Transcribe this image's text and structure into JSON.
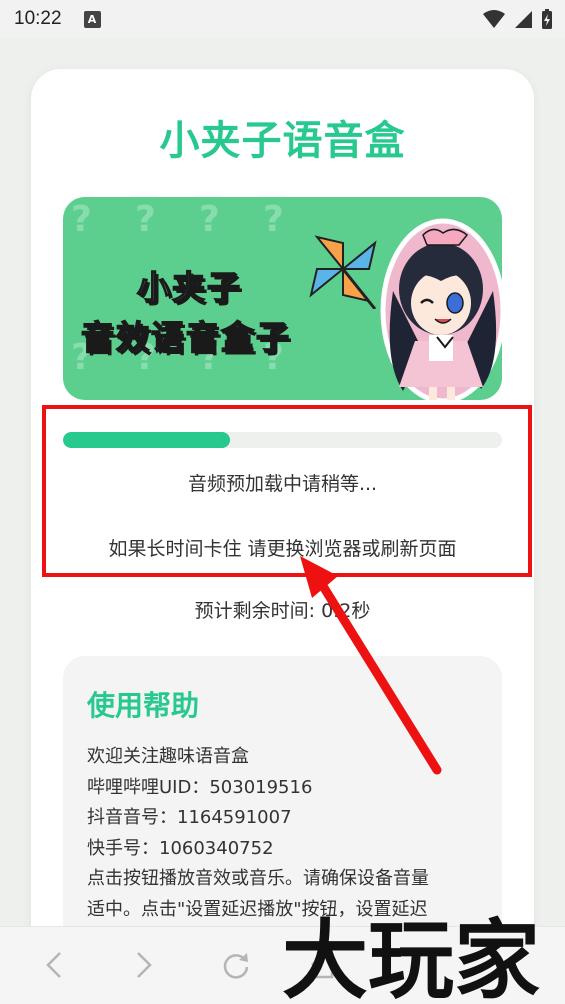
{
  "status_bar": {
    "time": "10:22",
    "notification_letter": "A"
  },
  "app": {
    "title": "小夹子语音盒"
  },
  "banner": {
    "line1": "小夹子",
    "line2": "音效语音盒子"
  },
  "loading": {
    "progress_percent": 38,
    "message": "音频预加载中请稍等...",
    "hint": "如果长时间卡住 请更换浏览器或刷新页面",
    "eta": "预计剩余时间: 0.2秒"
  },
  "help": {
    "title": "使用帮助",
    "lines": [
      "欢迎关注趣味语音盒",
      "哔哩哔哩UID：503019516",
      "抖音音号：1164591007",
      "快手号：1060340752",
      "点击按钮播放音效或音乐。请确保设备音量",
      "适中。点击\"设置延迟播放\"按钮，设置延迟"
    ]
  },
  "watermark": {
    "text": "大玩家"
  },
  "icons": {
    "back": "chevron-left-icon",
    "forward": "chevron-right-icon",
    "refresh": "refresh-icon",
    "home": "home-icon"
  },
  "colors": {
    "accent": "#27c98f",
    "highlight": "#ee1111"
  }
}
